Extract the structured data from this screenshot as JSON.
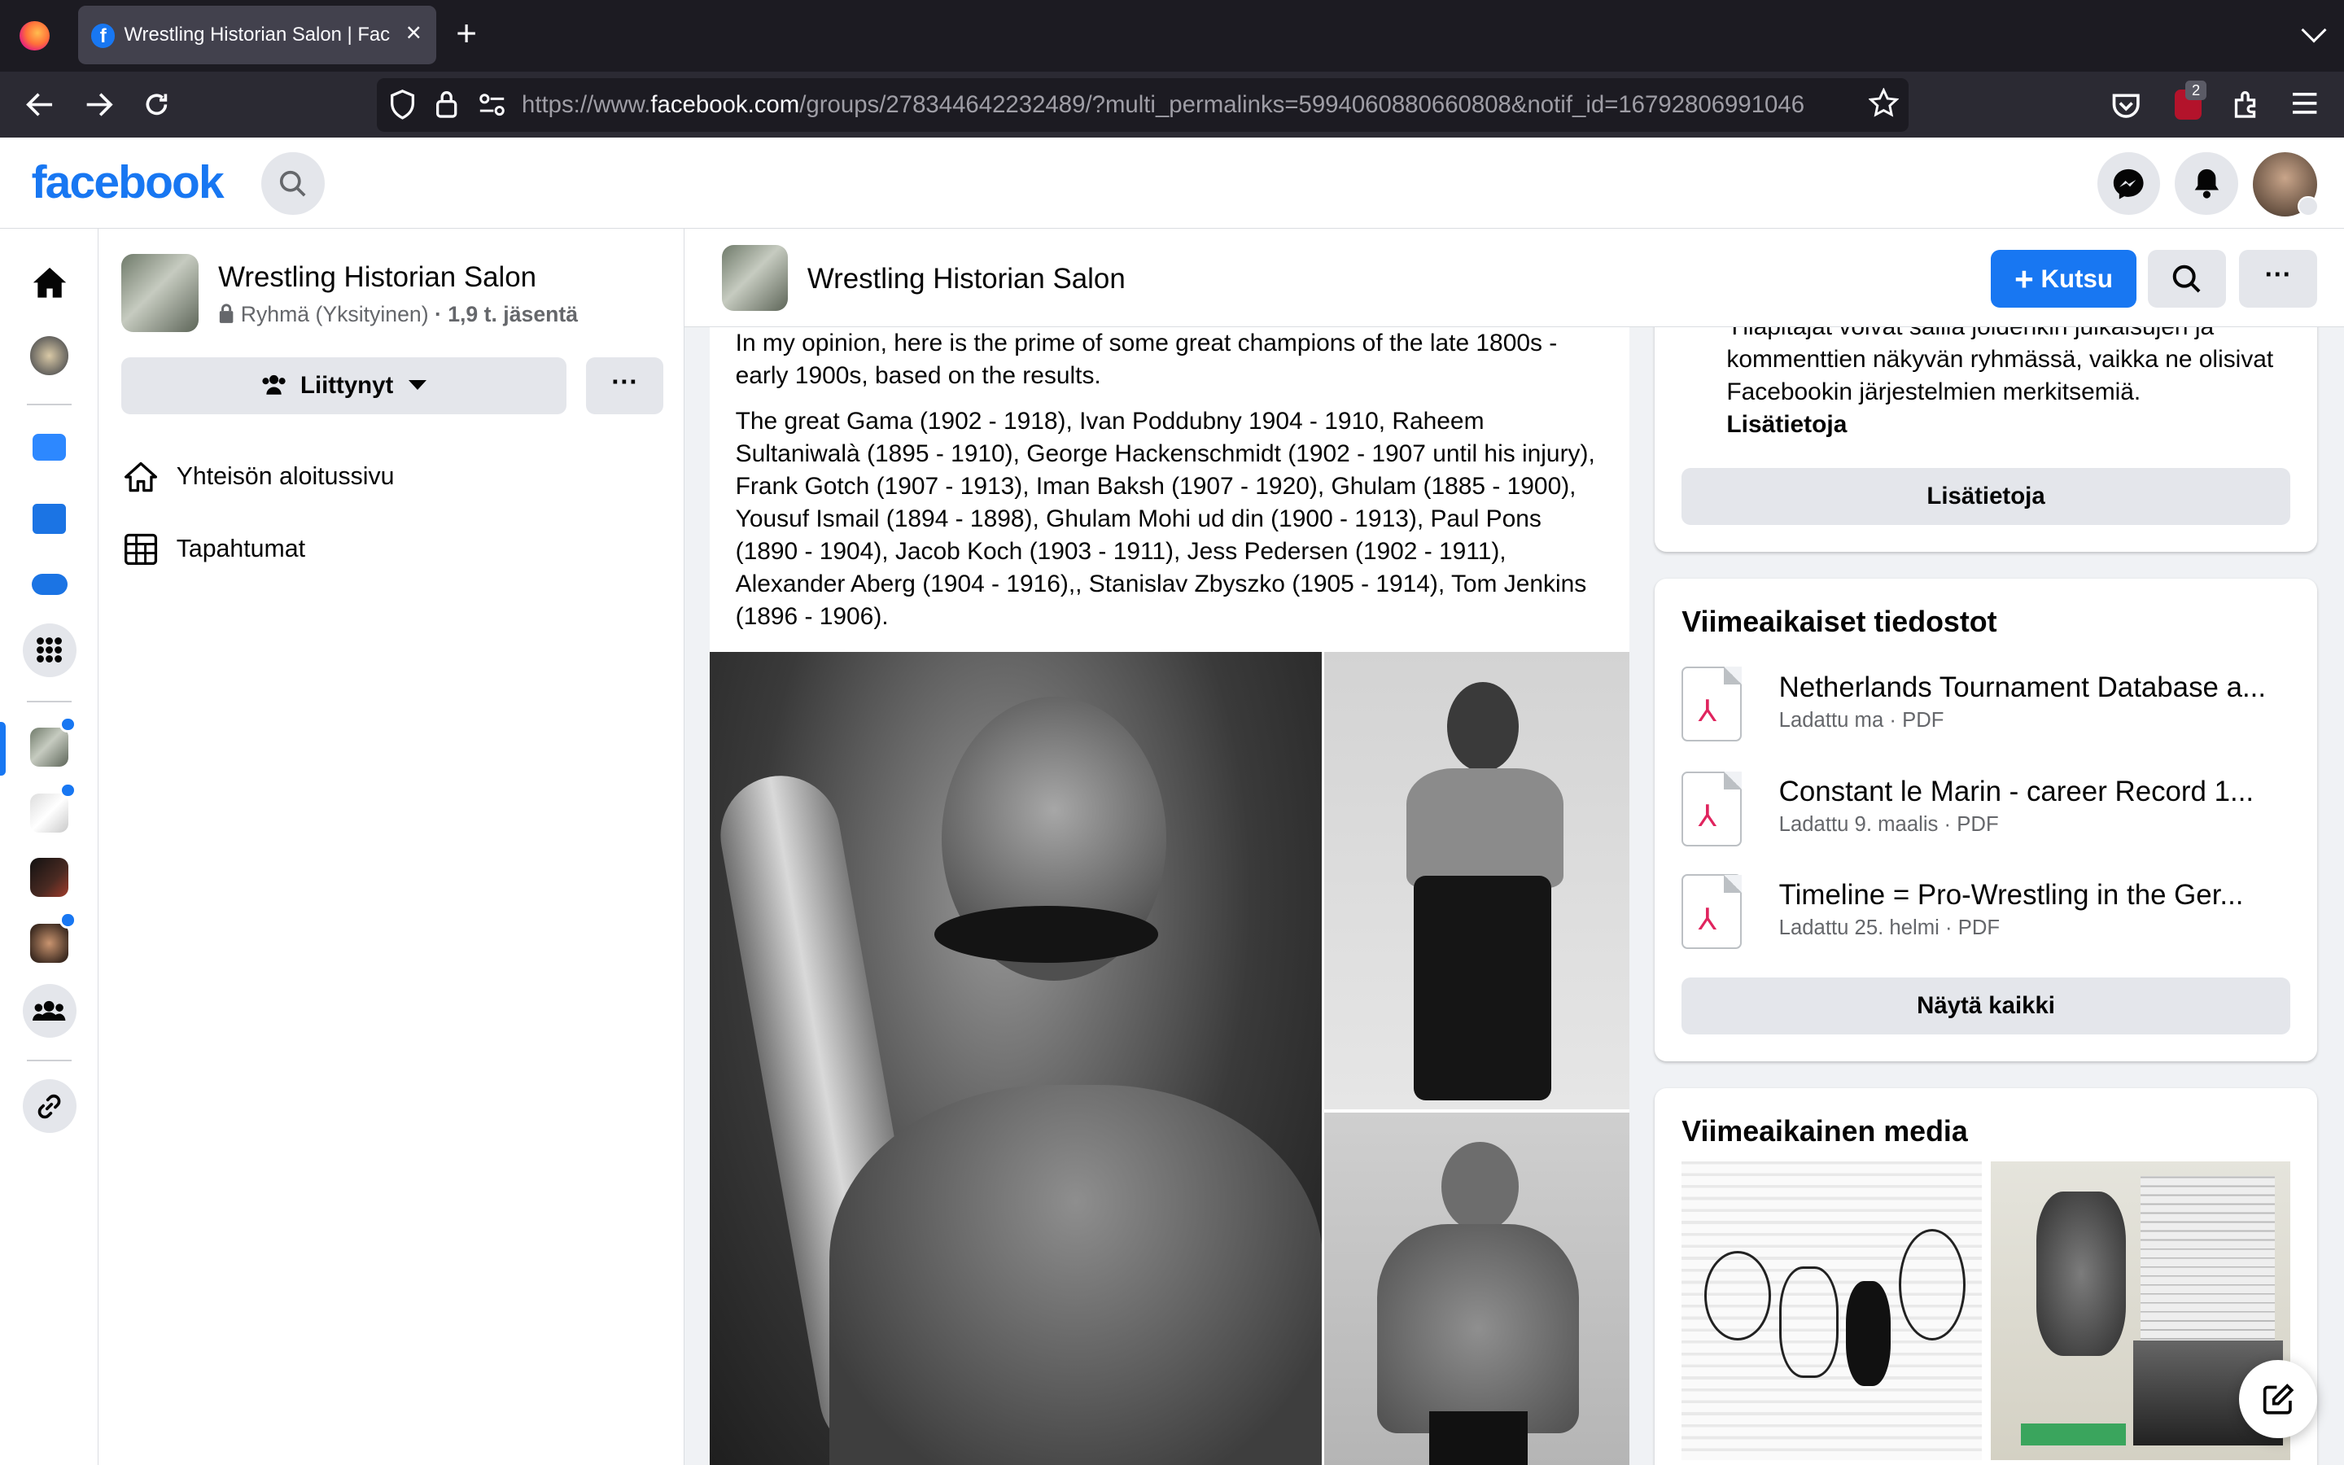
{
  "browser": {
    "tab_title": "Wrestling Historian Salon | Facebook",
    "tab_close": "×",
    "new_tab": "+",
    "url_prefix": "https://www.",
    "url_domain": "facebook.com",
    "url_path": "/groups/278344642232489/?multi_permalinks=5994060880660808&notif_id=16792806991046",
    "extension_badge": "2"
  },
  "fb": {
    "logo": "facebook"
  },
  "group": {
    "name": "Wrestling Historian Salon",
    "privacy": "Ryhmä (Yksityinen)",
    "members": "· 1,9 t. jäsentä",
    "joined_label": "Liittynyt",
    "more": "···",
    "nav": [
      {
        "label": "Yhteisön aloitussivu"
      },
      {
        "label": "Tapahtumat"
      }
    ]
  },
  "header": {
    "title": "Wrestling Historian Salon",
    "invite_label": "Kutsu",
    "more": "···"
  },
  "post": {
    "paragraph1": "In my opinion, here is the prime of some great champions of the late 1800s - early 1900s, based on the results.",
    "paragraph2": "The great Gama (1902 - 1918), Ivan Poddubny 1904 - 1910, Raheem Sultaniwalà (1895 - 1910), George Hackenschmidt (1902 - 1907 until his injury), Frank Gotch (1907 - 1913), Iman Baksh (1907 - 1920), Ghulam (1885 - 1900), Yousuf Ismail (1894 - 1898), Ghulam Mohi ud din (1900 - 1913), Paul Pons (1890 - 1904), Jacob Koch (1903 - 1911), Jess Pedersen (1902 - 1911), Alexander Aberg (1904 - 1916),, Stanislav Zbyszko (1905 - 1914), Tom Jenkins (1896 - 1906)."
  },
  "about_card": {
    "text": "Ylläpitäjät voivat sallia joidenkin julkaisujen ja kommenttien näkyvän ryhmässä, vaikka ne olisivat Facebookin järjestelmien merkitsemiä.",
    "link": "Lisätietoja",
    "button": "Lisätietoja"
  },
  "files": {
    "heading": "Viimeaikaiset tiedostot",
    "items": [
      {
        "title": "Netherlands Tournament Database a...",
        "meta": "Ladattu ma · PDF"
      },
      {
        "title": "Constant le Marin - career Record 1...",
        "meta": "Ladattu 9. maalis · PDF"
      },
      {
        "title": "Timeline = Pro-Wrestling in the Ger...",
        "meta": "Ladattu 25. helmi · PDF"
      }
    ],
    "show_all": "Näytä kaikki"
  },
  "media": {
    "heading": "Viimeaikainen media"
  },
  "colors": {
    "fb_blue": "#1877f2",
    "notification": "#1877f2",
    "pdf_red": "#e0245e"
  }
}
